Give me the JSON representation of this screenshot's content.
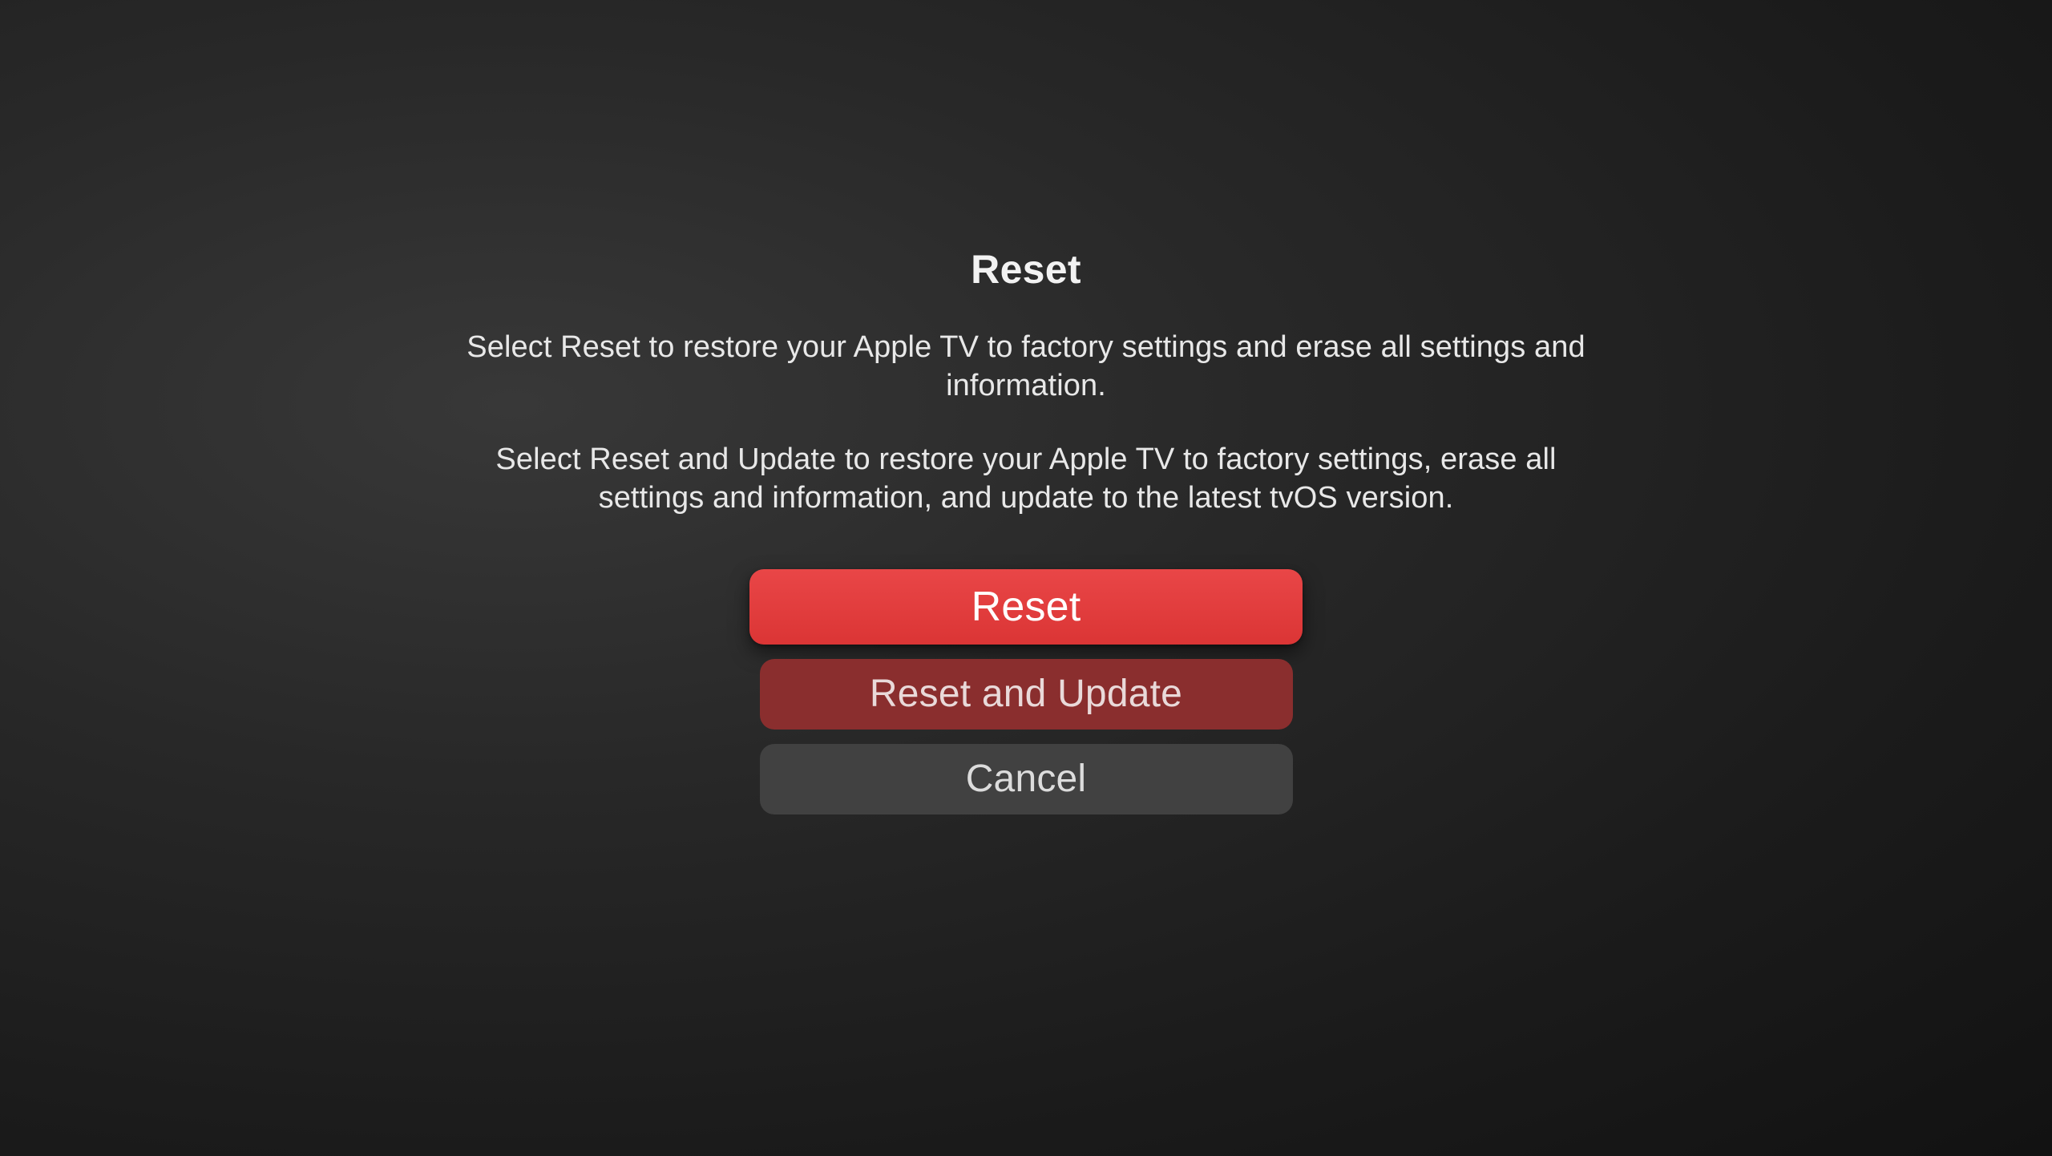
{
  "dialog": {
    "title": "Reset",
    "description1": "Select Reset to restore your Apple TV to factory settings and erase all settings and information.",
    "description2": "Select Reset and Update to restore your Apple TV to factory settings, erase all settings and information, and update to the latest tvOS version.",
    "buttons": {
      "reset": "Reset",
      "reset_and_update": "Reset and Update",
      "cancel": "Cancel"
    }
  }
}
